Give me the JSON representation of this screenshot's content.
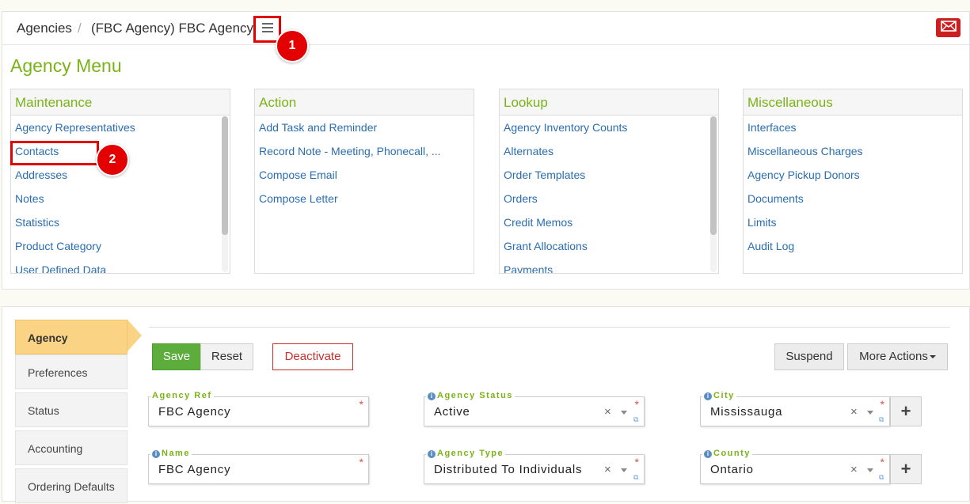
{
  "breadcrumb": {
    "item1": "Agencies",
    "separator": "/",
    "item2": "(FBC Agency) FBC Agency"
  },
  "icons": {
    "menu": "hamburger-menu-icon",
    "mail": "envelope-icon"
  },
  "colors": {
    "accent_green": "#7ab317",
    "link_blue": "#2a6db0",
    "highlight_red": "#e30000",
    "active_tab": "#fbd385",
    "save_green": "#5cad3c"
  },
  "annotations": {
    "badge1": "1",
    "badge2": "2"
  },
  "agency_menu": {
    "title": "Agency Menu",
    "columns": [
      {
        "heading": "Maintenance",
        "items": [
          "Agency Representatives",
          "Contacts",
          "Addresses",
          "Notes",
          "Statistics",
          "Product Category",
          "User Defined Data"
        ]
      },
      {
        "heading": "Action",
        "items": [
          "Add Task and Reminder",
          "Record Note - Meeting, Phonecall, ...",
          "Compose Email",
          "Compose Letter"
        ]
      },
      {
        "heading": "Lookup",
        "items": [
          "Agency Inventory Counts",
          "Alternates",
          "Order Templates",
          "Orders",
          "Credit Memos",
          "Grant Allocations",
          "Payments"
        ]
      },
      {
        "heading": "Miscellaneous",
        "items": [
          "Interfaces",
          "Miscellaneous Charges",
          "Agency Pickup Donors",
          "Documents",
          "Limits",
          "Audit Log"
        ]
      }
    ]
  },
  "side_tabs": [
    "Agency",
    "Preferences",
    "Status",
    "Accounting",
    "Ordering Defaults"
  ],
  "buttons": {
    "save": "Save",
    "reset": "Reset",
    "deactivate": "Deactivate",
    "suspend": "Suspend",
    "more_actions": "More Actions"
  },
  "fields": {
    "agency_ref": {
      "label": "Agency Ref",
      "value": "FBC Agency",
      "required": "*"
    },
    "agency_status": {
      "label": "Agency Status",
      "value": "Active",
      "required": "*"
    },
    "city": {
      "label": "City",
      "value": "Mississauga",
      "required": "*"
    },
    "name": {
      "label": "Name",
      "value": "FBC Agency",
      "required": "*"
    },
    "agency_type": {
      "label": "Agency Type",
      "value": "Distributed To Individuals",
      "required": "*"
    },
    "county": {
      "label": "County",
      "value": "Ontario",
      "required": "*"
    }
  },
  "glyphs": {
    "clear": "×",
    "plus": "+",
    "info": "i",
    "external": "⧉"
  }
}
